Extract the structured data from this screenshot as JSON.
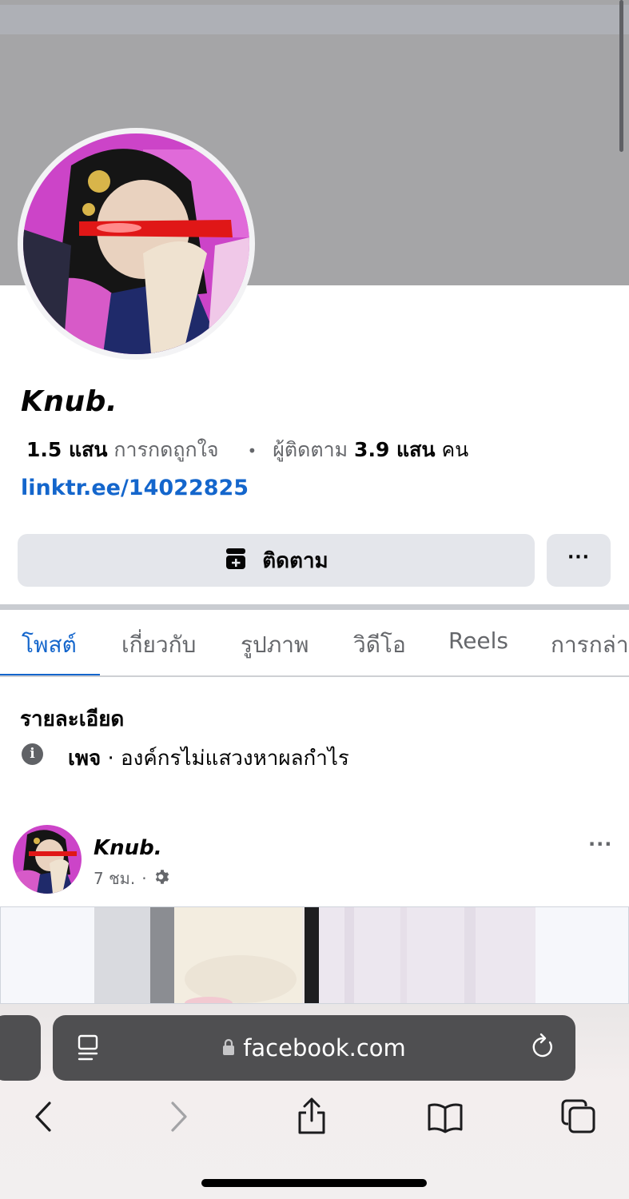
{
  "profile": {
    "name": "Knub.",
    "likes_count": "1.5 แสน",
    "likes_label": "การกดถูกใจ",
    "followers_label": "ผู้ติดตาม",
    "followers_count": "3.9 แสน",
    "followers_unit": "คน",
    "link": "linktr.ee/14022825"
  },
  "actions": {
    "follow_label": "ติดตาม",
    "more_label": "···"
  },
  "tabs": [
    {
      "label": "โพสต์",
      "active": true
    },
    {
      "label": "เกี่ยวกับ",
      "active": false
    },
    {
      "label": "รูปภาพ",
      "active": false
    },
    {
      "label": "วิดีโอ",
      "active": false
    },
    {
      "label": "Reels",
      "active": false
    },
    {
      "label": "การกล่า",
      "active": false
    }
  ],
  "details": {
    "title": "รายละเอียด",
    "page_label": "เพจ",
    "category": " · องค์กรไม่แสวงหาผลกำไร"
  },
  "post": {
    "author": "Knub.",
    "time": "7 ชม.",
    "separator": "·",
    "more_label": "···"
  },
  "browser": {
    "url": "facebook.com"
  },
  "colors": {
    "accent": "#1466cc",
    "button_bg": "#e4e6eb",
    "cover": "#a5a5a7",
    "urlbar": "#4f4f51"
  },
  "icons": [
    "archive-plus-icon",
    "info-icon",
    "gear-icon",
    "lock-icon",
    "reader-icon",
    "reload-icon",
    "back-icon",
    "forward-icon",
    "share-icon",
    "bookmarks-icon",
    "tabs-icon"
  ]
}
